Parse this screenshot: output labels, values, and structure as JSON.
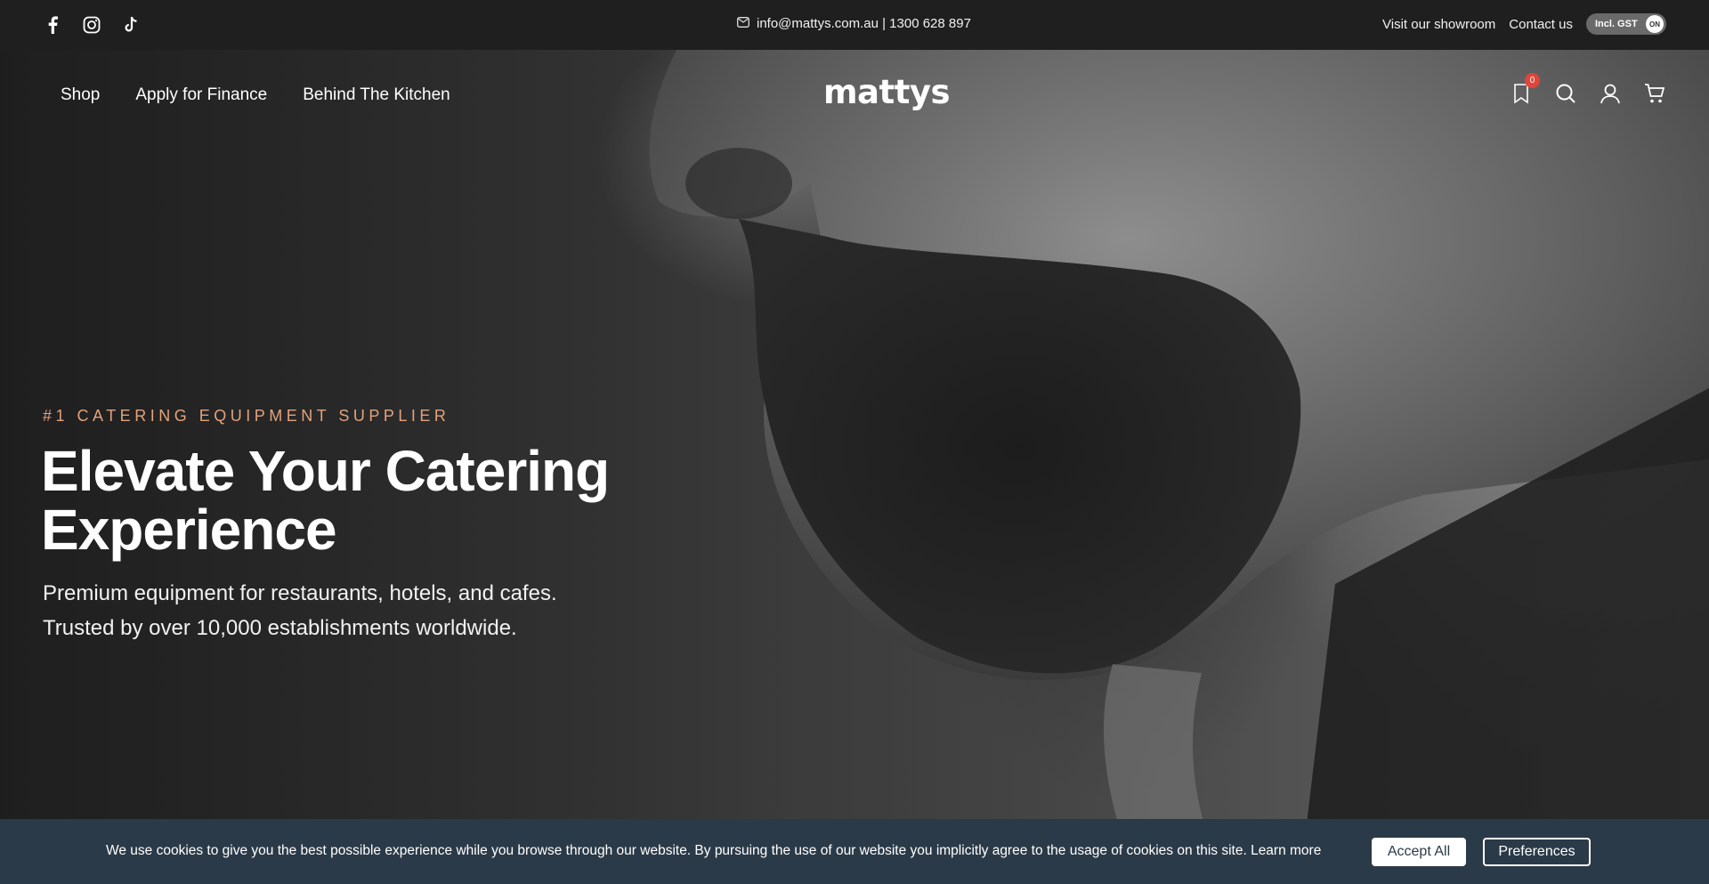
{
  "topbar": {
    "social": [
      "facebook-icon",
      "instagram-icon",
      "tiktok-icon"
    ],
    "contact": "info@mattys.com.au | 1300 628 897",
    "links": {
      "showroom": "Visit our showroom",
      "contact": "Contact us"
    },
    "gst_toggle": {
      "label": "Incl. GST",
      "state": "ON"
    }
  },
  "nav": {
    "items": [
      "Shop",
      "Apply for Finance",
      "Behind The Kitchen"
    ],
    "logo": "mattys",
    "wishlist_count": "0",
    "icons": [
      "bookmark-icon",
      "search-icon",
      "account-icon",
      "cart-icon"
    ]
  },
  "hero": {
    "eyebrow": "#1 CATERING EQUIPMENT SUPPLIER",
    "headline": "Elevate Your Catering Experience",
    "subline": "Premium equipment for restaurants, hotels, and cafes. Trusted by over 10,000 establishments worldwide."
  },
  "cookie": {
    "text": "We use cookies to give you the best possible experience while you browse through our website. By pursuing the use of our website you implicitly agree to the usage of cookies on this site. Learn more",
    "accept": "Accept All",
    "preferences": "Preferences"
  },
  "colors": {
    "topbar": "#1f1f1f",
    "eyebrow": "#e3a27c",
    "cookie_bar": "#2b3a48",
    "badge": "#e0453a"
  }
}
